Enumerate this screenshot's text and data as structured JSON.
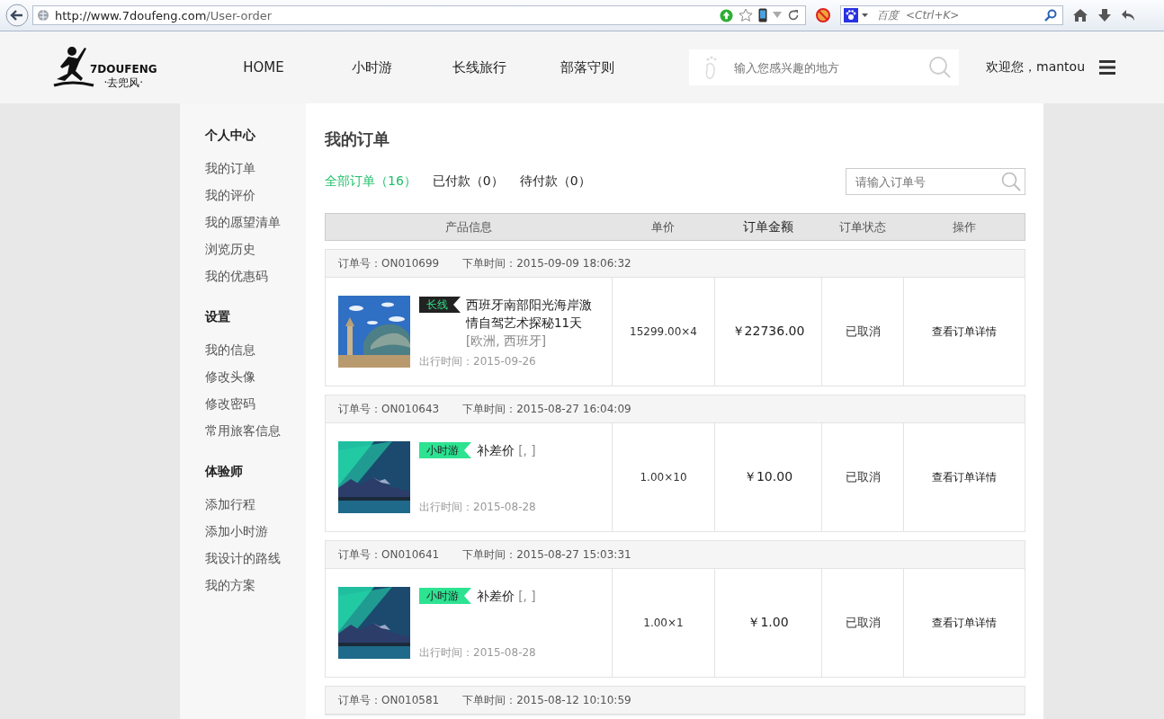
{
  "browser": {
    "url_host": "http://www.7doufeng.com",
    "url_path": "/User-order",
    "search_engine": "百度",
    "search_placeholder": "<Ctrl+K>"
  },
  "header": {
    "logo_text": "7DOUFENG",
    "logo_sub": "·去兜风·",
    "nav": [
      {
        "label": "HOME"
      },
      {
        "label": "小时游"
      },
      {
        "label": "长线旅行"
      },
      {
        "label": "部落守则"
      }
    ],
    "search_placeholder": "输入您感兴趣的地方",
    "greeting": "欢迎您，mantou"
  },
  "sidebar": [
    {
      "title": "个人中心",
      "items": [
        "我的订单",
        "我的评价",
        "我的愿望清单",
        "浏览历史",
        "我的优惠码"
      ]
    },
    {
      "title": "设置",
      "items": [
        "我的信息",
        "修改头像",
        "修改密码",
        "常用旅客信息"
      ]
    },
    {
      "title": "体验师",
      "items": [
        "添加行程",
        "添加小时游",
        "我设计的路线",
        "我的方案"
      ]
    }
  ],
  "page_title": "我的订单",
  "filters": [
    {
      "label": "全部订单（16）",
      "selected": true
    },
    {
      "label": "已付款（0）",
      "selected": false
    },
    {
      "label": "待付款（0）",
      "selected": false
    }
  ],
  "order_search_placeholder": "请输入订单号",
  "columns": [
    "产品信息",
    "单价",
    "订单金额",
    "订单状态",
    "操作"
  ],
  "orders": [
    {
      "number": "订单号：ON010699",
      "time": "下单时间：2015-09-09 18:06:32",
      "tag": {
        "kind": "long",
        "label": "长线"
      },
      "title": "西班牙南部阳光海岸激情自驾艺术探秘11天",
      "location": "[欧洲, 西班牙]",
      "travel_date": "出行时间：2015-09-26",
      "unit_price": "15299.00×4",
      "amount": "￥22736.00",
      "status": "已取消",
      "action": "查看订单详情"
    },
    {
      "number": "订单号：ON010643",
      "time": "下单时间：2015-08-27 16:04:09",
      "tag": {
        "kind": "short",
        "label": "小时游"
      },
      "title": "补差价",
      "location": "[, ]",
      "travel_date": "出行时间：2015-08-28",
      "unit_price": "1.00×10",
      "amount": "￥10.00",
      "status": "已取消",
      "action": "查看订单详情"
    },
    {
      "number": "订单号：ON010641",
      "time": "下单时间：2015-08-27 15:03:31",
      "tag": {
        "kind": "short",
        "label": "小时游"
      },
      "title": "补差价",
      "location": "[, ]",
      "travel_date": "出行时间：2015-08-28",
      "unit_price": "1.00×1",
      "amount": "￥1.00",
      "status": "已取消",
      "action": "查看订单详情"
    },
    {
      "number": "订单号：ON010581",
      "time": "下单时间：2015-08-12 10:10:59"
    }
  ]
}
